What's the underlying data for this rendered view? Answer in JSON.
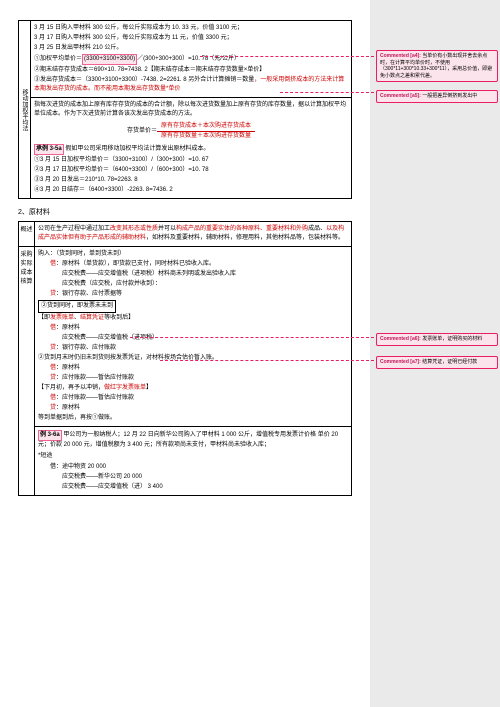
{
  "table1": {
    "sidelabel": "移动加权平均法",
    "line1": "3 月 15 日购入甲材料 300 公斤，每公斤实际成本为 10. 33 元，价值 3100 元；",
    "line2": "3 月 17 日购入甲材料 300 公斤，每公斤实际成本为 11 元，价值 3300 元；",
    "line3": "3 月 25 日发出甲材料 210 公斤。",
    "calc1_prefix": "①加权平均单价＝",
    "calc1_hl": "(3300+3100+3300)",
    "calc1_suffix": "／(300+300+300）=10. 78（元/公斤）",
    "calc2": "②期末结存存货成本＝690×10. 78=7438. 2【期末结存成本＝期末结存存货数量×单价】",
    "calc3_prefix": "③发出存货成本＝（3300+3100+3300）-7438. 2=2261. 8 另外合计计算摊销＝数量",
    "calc3_red": "，一般采用倒挤成本的方法来计算本期发出存货的成本。而不能用本期发出存货数量*单价",
    "line_after_calc3": "",
    "para1": "指每次进货的成本加上原有库存存货的成本的合计额，除以每次进货数量加上原有存货的库存数量，据以计算加权平均单位成本。作为下次进货前计算各该次发出存货成本的方法。",
    "formula_label": "存货单价＝",
    "formula_top": "原有存货成本＋本次购进存货成本",
    "formula_bot": "原有存货数量＋本次购进存货数量",
    "ex_label": "承例 3-5a",
    "ex_main": "假如甲公司采用移动加权平均法计算发出原材料成本。",
    "ex1": "①3 月 15 日加权平均单价＝（3300+3100）/（300+300）=10. 67",
    "ex2": "②3 月 17 日加权平均单价＝（6400+3300）/（600+300）=10. 78",
    "ex3": "③3 月 20 日发出＝210*10. 78=2263. 8",
    "ex4": "④3 月 20 日结存＝（6400+3300）-2263. 8=7436. 2"
  },
  "section2": {
    "title": "2、原材料",
    "overview_label": "概述",
    "overview1": "公司在生产过程中通过加工改变其形态或性质并可以构成产品的重要实体的各种原料、重要材料和外购品成品、以及构成产品实体但有助于产品形成的辅助材料，如材料及重要材料，辅助材料，修理用料，其他材料品等，包装材料等。",
    "purchase_label": "采购实际成本核算",
    "purchase_intro": "购入：（货到同时，单到货未到）",
    "p1": "借：原材料（单货款），即货款已支付，同时材料已验收入库。",
    "p2": "应交税费——应交增值税（进项税）材料商未列明或发出验收入库",
    "p3a": "应交税费（应交税，应付款并收到）：",
    "p4": "贷：银行存款、应付票据等",
    "p5": "②货到同时，即发票未未到",
    "p5r": "【即发票账单、结算凭证等收到后】",
    "p6": "借：原材料",
    "p7": "应交税费——应交增值税（进项税）",
    "p8": "贷：银行存款、应付账款",
    "p9": "②货到月末时仍旧未到货则按发票凭证，对材料按场合估价暂入账。",
    "p10": "借：原材料",
    "p11": "贷：应付账款——暂估应付账款",
    "p12": "【下月初，再予以冲销，做红字发票账单】",
    "p13": "借：应付账款——暂估应付账款",
    "p14": "贷：原材料",
    "p15": "等到单据到后，再按①做账。",
    "ex_label": "例 3-6a",
    "ex_main": "甲公司为一般纳税人；12 月 22 日向新华公司购入了甲材料 1 000 公斤，增值税专用发票计价格 单价 20 元；价款 20 000 元，增值税额为 3 400 元；所有款项尚未支付，甲材料尚未验收入库；",
    "ex_j1": "借：途中物资 20 000",
    "ex_j2": "应交税费——新华公司 20 000",
    "ex_j3": "应交税费——应交增值税（进） 3 400",
    "note": "*短途"
  },
  "comments": {
    "c1_label": "Commented [a4]:",
    "c1_text": "当单价有小数出现并舍去余点时，在计算平均单价时，不使用（300*11+300*10.33+300*11），采用总价值，即避免小数点之差和累代差。",
    "c2_label": "Commented [a5]:",
    "c2_text": "一般把差异倒挤到发出中",
    "c3_label": "Commented [a6]:",
    "c3_text": "发票账单，证明购买的材料",
    "c4_label": "Commented [a7]:",
    "c4_text": "结算凭证，证明已经付款"
  }
}
